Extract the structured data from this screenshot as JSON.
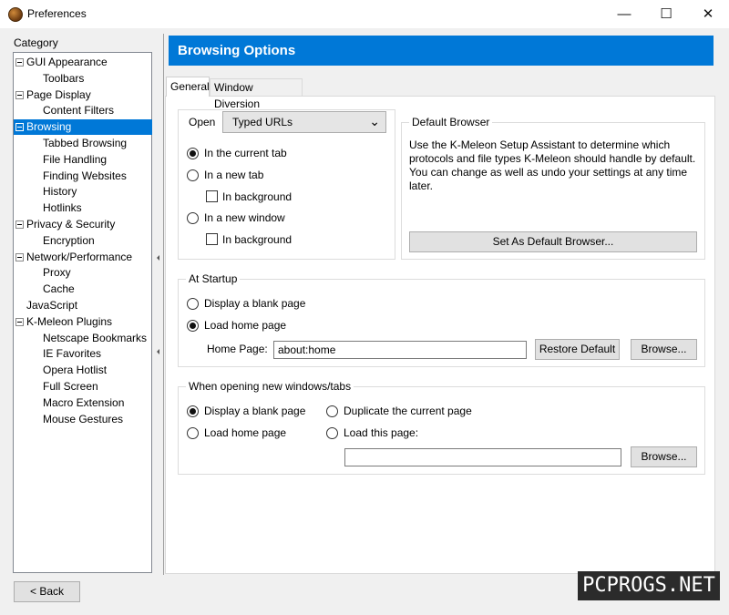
{
  "window": {
    "title": "Preferences",
    "minimize_glyph": "—",
    "maximize_glyph": "☐",
    "close_glyph": "✕"
  },
  "category": {
    "label": "Category",
    "items": [
      {
        "label": "GUI Appearance",
        "level": 0,
        "expander": true
      },
      {
        "label": "Toolbars",
        "level": 1
      },
      {
        "label": "Page Display",
        "level": 0,
        "expander": true
      },
      {
        "label": "Content Filters",
        "level": 1
      },
      {
        "label": "Browsing",
        "level": 0,
        "expander": true,
        "selected": true
      },
      {
        "label": "Tabbed Browsing",
        "level": 1
      },
      {
        "label": "File Handling",
        "level": 1
      },
      {
        "label": "Finding Websites",
        "level": 1
      },
      {
        "label": "History",
        "level": 1
      },
      {
        "label": "Hotlinks",
        "level": 1
      },
      {
        "label": "Privacy & Security",
        "level": 0,
        "expander": true
      },
      {
        "label": "Encryption",
        "level": 1
      },
      {
        "label": "Network/Performance",
        "level": 0,
        "expander": true
      },
      {
        "label": "Proxy",
        "level": 1
      },
      {
        "label": "Cache",
        "level": 1
      },
      {
        "label": "JavaScript",
        "level": 0
      },
      {
        "label": "K-Meleon Plugins",
        "level": 0,
        "expander": true
      },
      {
        "label": "Netscape Bookmarks",
        "level": 1
      },
      {
        "label": "IE Favorites",
        "level": 1
      },
      {
        "label": "Opera Hotlist",
        "level": 1
      },
      {
        "label": "Full Screen",
        "level": 1
      },
      {
        "label": "Macro Extension",
        "level": 1
      },
      {
        "label": "Mouse Gestures",
        "level": 1
      }
    ]
  },
  "header": {
    "title": "Browsing Options"
  },
  "tabs": {
    "general": "General",
    "window_diversion": "Window Diversion"
  },
  "open_section": {
    "label": "Open",
    "select_value": "Typed URLs",
    "in_current_tab": "In the current tab",
    "in_new_tab": "In a new tab",
    "in_background_1": "In background",
    "in_new_window": "In a new window",
    "in_background_2": "In background"
  },
  "default_browser": {
    "legend": "Default Browser",
    "text": "Use the K-Meleon Setup Assistant to determine which protocols and file types K-Meleon should handle by default. You can change as well as undo your settings at any time later.",
    "button": "Set As Default Browser..."
  },
  "startup": {
    "legend": "At Startup",
    "blank_page": "Display a blank page",
    "home_page": "Load home page",
    "home_label": "Home Page:",
    "home_value": "about:home",
    "restore_button": "Restore Default",
    "browse_button": "Browse..."
  },
  "new_windows": {
    "legend": "When opening new windows/tabs",
    "blank_page": "Display a blank page",
    "duplicate": "Duplicate the current page",
    "home_page": "Load home page",
    "load_this": "Load this page:",
    "page_value": "",
    "browse_button": "Browse..."
  },
  "footer": {
    "back_button": "< Back"
  },
  "watermark": "PCPROGS.NET"
}
